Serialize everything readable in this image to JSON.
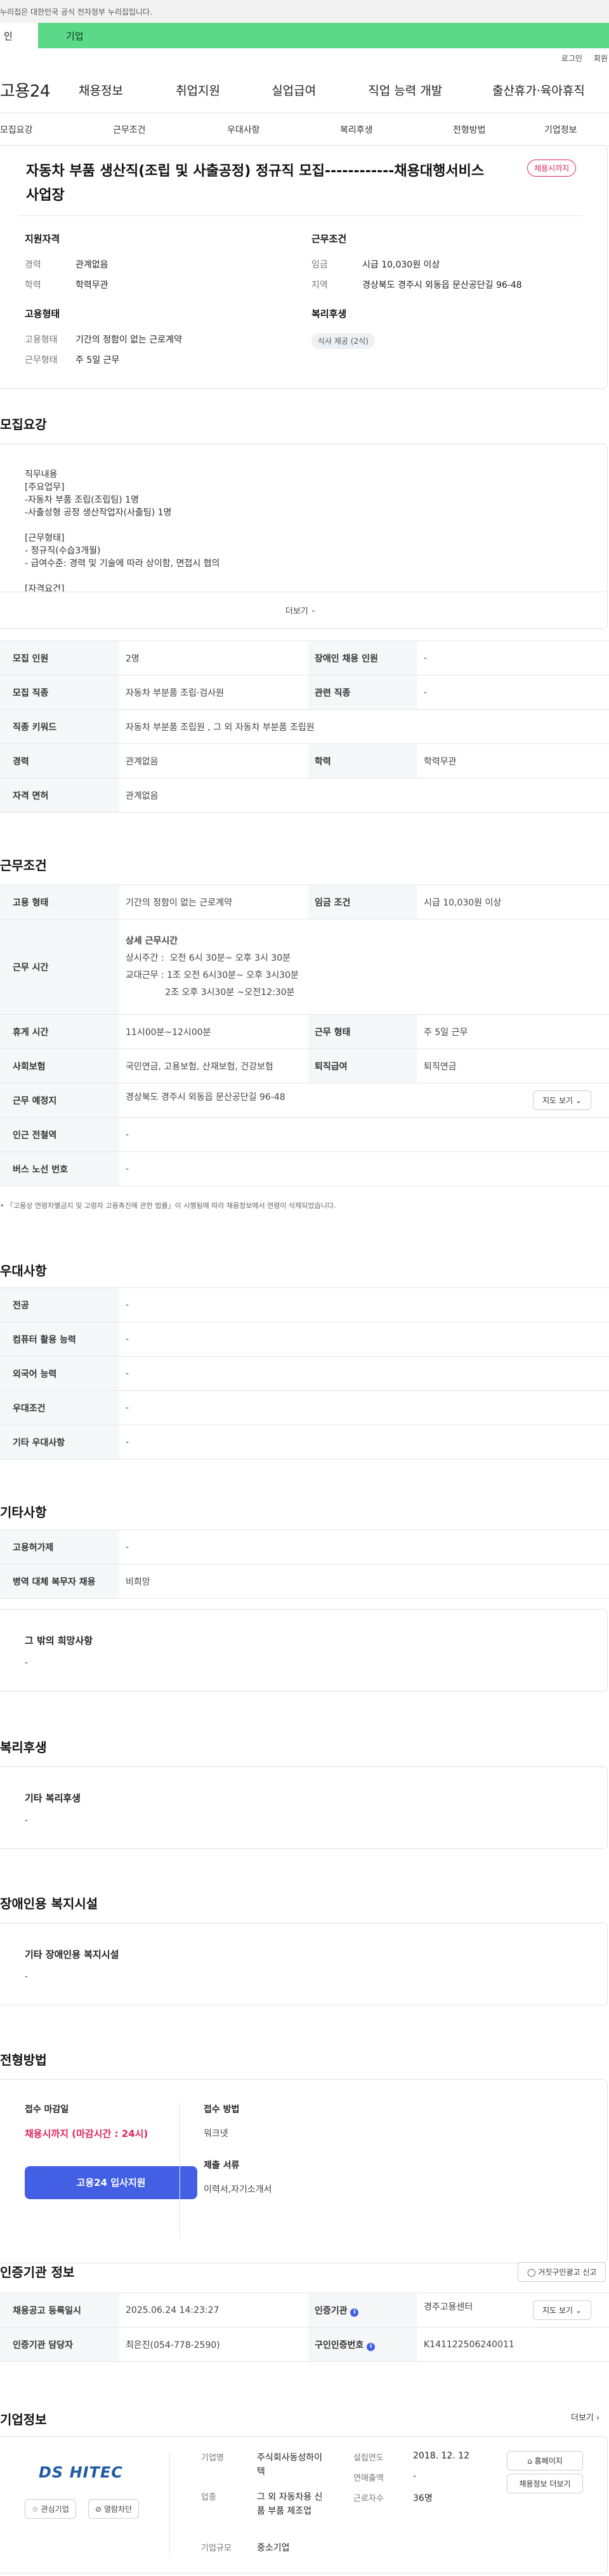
{
  "gov_notice": "누리집은 대한민국 공식 전자정부 누리집입니다.",
  "user_tabs": {
    "personal": "인",
    "company": "기업"
  },
  "util": {
    "login": "로그인",
    "join": "회원"
  },
  "gnb": {
    "logo": "고용24",
    "menus": [
      "채용정보",
      "취업지원",
      "실업급여",
      "직업 능력 개발",
      "출산휴가·육아휴직"
    ]
  },
  "subtabs": [
    "모집요강",
    "근무조건",
    "우대사항",
    "복리후생",
    "전형방법",
    "기업정보"
  ],
  "job": {
    "title": "자동차 부품 생산직(조립 및 사출공정) 정규직 모집------------채용대행서비스 사업장",
    "status": "채용시까지"
  },
  "summary": {
    "qual": {
      "heading": "지원자격",
      "career_k": "경력",
      "career_v": "관계없음",
      "edu_k": "학력",
      "edu_v": "학력무관"
    },
    "type": {
      "heading": "고용형태",
      "emp_k": "고용형태",
      "emp_v": "기간의 정함이 없는 근로계약",
      "work_k": "근무형태",
      "work_v": "주 5일 근무"
    },
    "cond": {
      "heading": "근무조건",
      "wage_k": "임금",
      "wage_v": "시급 10,030원 이상",
      "region_k": "지역",
      "region_v": "경상북도 경주시 외동읍 문산공단길 96-48"
    },
    "welfare": {
      "heading": "복리후생",
      "chip": "식사 제공 (2식)"
    }
  },
  "recruit": {
    "section_title": "모집요강",
    "desc_title": "직무내용",
    "desc_body": "[주요업무]\n -자동차 부품 조립(조립팀) 1명\n -사출성형 공정 생산작업자(사출팀) 1명\n\n[근무형태]\n- 정규직(수습3개월)\n- 급여수준: 경력 및 기술에 따라  상이함, 면접시 협의\n\n[자격요건]",
    "more": "더보기",
    "rows": [
      {
        "k1": "모집 인원",
        "v1": "2명",
        "k2": "장애인 채용 인원",
        "v2": "-"
      },
      {
        "k1": "모집 직종",
        "v1": "자동차 부분품 조립·검사원",
        "k2": "관련 직종",
        "v2": "-"
      },
      {
        "k1": "직종 키워드",
        "v1": "자동차 부분품 조립원 , 그 외 자동차 부분품 조립원"
      },
      {
        "k1": "경력",
        "v1": "관계없음",
        "k2": "학력",
        "v2": "학력무관"
      },
      {
        "k1": "자격 면허",
        "v1": "관계없음"
      }
    ]
  },
  "work": {
    "section_title": "근무조건",
    "emp_k": "고용 형태",
    "emp_v": "기간의 정함이 없는 근로계약",
    "wage_k": "임금 조건",
    "wage_v": "시급 10,030원 이상",
    "hours_k": "근무 시간",
    "hours_lines": [
      "상세 근무시간",
      "상시주간 :  오전 6시 30분~ 오후 3시 30분",
      "교대근무 : 1조 오전 6시30분~ 오후 3시30분",
      "              2조 오후 3시30분 ~오전12:30분"
    ],
    "rest_k": "휴게 시간",
    "rest_v": "11시00분~12시00분",
    "form_k": "근무 형태",
    "form_v": "주 5일 근무",
    "ins_k": "사회보험",
    "ins_v": "국민연금, 고용보험, 산재보험, 건강보험",
    "ret_k": "퇴직급여",
    "ret_v": "퇴직연금",
    "place_k": "근무 예정지",
    "place_v": "경상북도 경주시 외동읍 문산공단길 96-48",
    "map_btn": "지도 보기",
    "subway_k": "인근 전철역",
    "subway_v": "-",
    "bus_k": "버스 노선 번호",
    "bus_v": "-",
    "note": "「고용상 연령차별금지 및 고령자 고용촉진에 관한 법률」이 시행됨에 따라 채용정보에서 연령이 삭제되었습니다."
  },
  "pref": {
    "section_title": "우대사항",
    "rows": [
      {
        "k": "전공",
        "v": "-"
      },
      {
        "k": "컴퓨터 활용 능력",
        "v": "-"
      },
      {
        "k": "외국어 능력",
        "v": "-"
      },
      {
        "k": "우대조건",
        "v": "-"
      },
      {
        "k": "기타 우대사항",
        "v": "-"
      }
    ]
  },
  "etc": {
    "section_title": "기타사항",
    "rows": [
      {
        "k": "고용허가제",
        "v": "-"
      },
      {
        "k": "병역 대체 복무자 채용",
        "v": "비희망"
      }
    ],
    "hope_title": "그 밖의 희망사항",
    "hope_v": "-"
  },
  "welfare": {
    "section_title": "복리후생",
    "h": "기타 복리후생",
    "v": "-"
  },
  "disabled": {
    "section_title": "장애인용 복지시설",
    "h": "기타 장애인용 복지시설",
    "v": "-"
  },
  "process": {
    "section_title": "전형방법",
    "deadline_k": "접수 마감일",
    "deadline_v": "채용시까지 (마감시간 : 24시)",
    "apply_btn": "고용24 입사지원",
    "method_k": "접수 방법",
    "method_v": "워크넷",
    "docs_k": "제출 서류",
    "docs_v": "이력서,자기소개서"
  },
  "agency": {
    "section_title": "인증기관 정보",
    "report_btn": "거짓구인광고 신고",
    "reg_k": "채용공고 등록일시",
    "reg_v": "2025.06.24 14:23:27",
    "org_k": "인증기관",
    "org_v": "경주고용센터",
    "map_btn": "지도 보기",
    "mgr_k": "인증기관 담당자",
    "mgr_v": "최은진(054-778-2590)",
    "no_k": "구인인증번호",
    "no_v": "K141122506240011"
  },
  "company": {
    "section_title": "기업정보",
    "more": "더보기",
    "logo_text": "DS HITEC",
    "fav_btn": "관심기업",
    "block_btn": "열람차단",
    "name_k": "기업명",
    "name_v": "주식회사동성하이텍",
    "ind_k": "업종",
    "ind_v": "그 외 자동차용 신품 부품 제조업",
    "size_k": "기업규모",
    "size_v": "중소기업",
    "est_k": "설립연도",
    "est_v": "2018. 12. 12",
    "sales_k": "연매출액",
    "sales_v": "-",
    "emp_k": "근로자수",
    "emp_v": "36명",
    "home_btn": "홈페이지",
    "jobs_btn": "채용정보 더보기"
  }
}
